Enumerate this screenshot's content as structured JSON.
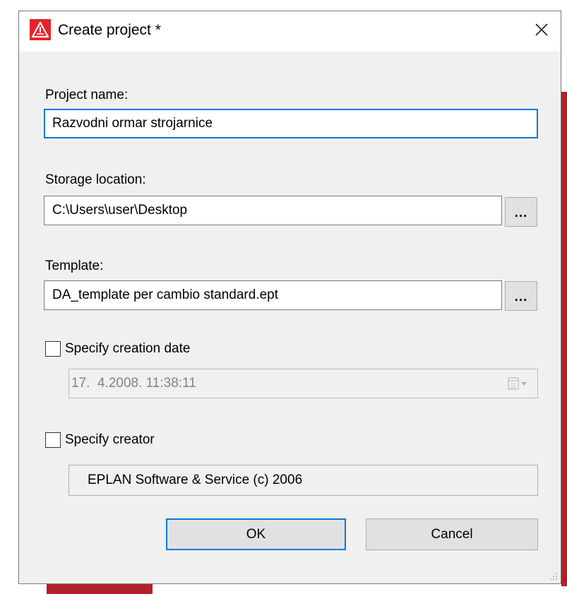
{
  "window": {
    "title": "Create project *",
    "app_icon": "eplan-warning-icon",
    "close_icon": "close-icon"
  },
  "form": {
    "project_name_label": "Project name:",
    "project_name_value": "Razvodni ormar strojarnice",
    "storage_label": "Storage location:",
    "storage_value": "C:\\Users\\user\\Desktop",
    "storage_browse_label": "...",
    "template_label": "Template:",
    "template_value": "DA_template per cambio standard.ept",
    "template_browse_label": "...",
    "creation_date_checkbox_label": "Specify creation date",
    "creation_date_checked": false,
    "creation_date_value": "17.  4.2008. 11:38:11",
    "creator_checkbox_label": "Specify creator",
    "creator_checked": false,
    "creator_value": "EPLAN Software & Service (c) 2006"
  },
  "buttons": {
    "ok_label": "OK",
    "cancel_label": "Cancel"
  },
  "colors": {
    "accent": "#0078d7",
    "brand_red": "#e3232b"
  }
}
